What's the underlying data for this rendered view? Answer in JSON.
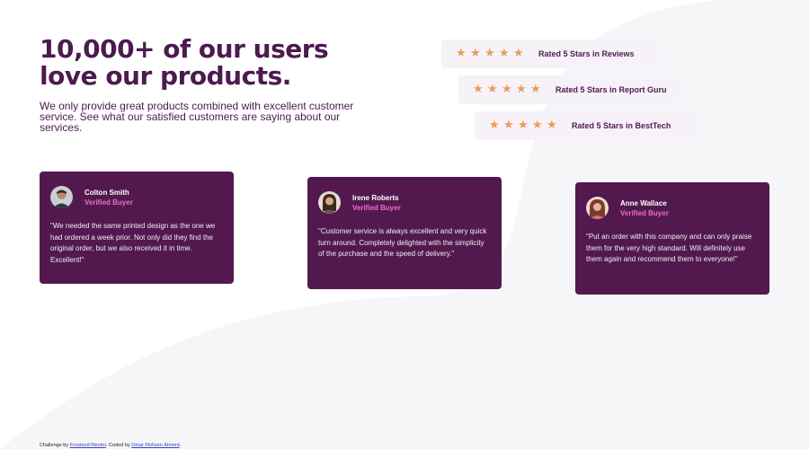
{
  "hero": {
    "title_line1": "10,000+ of our users",
    "title_line2": "love our products.",
    "description": "We only provide great products combined with excellent customer service. See what our satisfied customers are saying about our services."
  },
  "ratings": [
    {
      "text": "Rated 5 Stars in Reviews",
      "stars": 5
    },
    {
      "text": "Rated 5 Stars in Report Guru",
      "stars": 5
    },
    {
      "text": "Rated 5 Stars in BestTech",
      "stars": 5
    }
  ],
  "testimonials": [
    {
      "name": "Colton Smith",
      "role": "Verified Buyer",
      "quote": "\"We needed the same printed design as the one we had ordered a week prior. Not only did they find the original order, but we also received it in time. Excellent!\""
    },
    {
      "name": "Irene Roberts",
      "role": "Verified Buyer",
      "quote": "\"Customer service is always excellent and very quick turn around. Completely delighted with the simplicity of the purchase and the speed of delivery.\""
    },
    {
      "name": "Anne Wallace",
      "role": "Verified Buyer",
      "quote": "\"Put an order with this company and can only praise them for the very high standard. Will definitely use them again and recommend them to everyone!\""
    }
  ],
  "footer": {
    "prefix": "Challenge by ",
    "link1": "Frontend Mentor",
    "middle": ". Coded by ",
    "link2": "Omar Mohsen Ahmed",
    "suffix": "."
  },
  "colors": {
    "primary": "#4b1b4f",
    "card_bg": "#52194f",
    "accent_pink": "#ee6cc0",
    "star": "#ee9c52",
    "rating_bg": "#f7f1f8"
  },
  "icons": {
    "star": "star-icon"
  }
}
